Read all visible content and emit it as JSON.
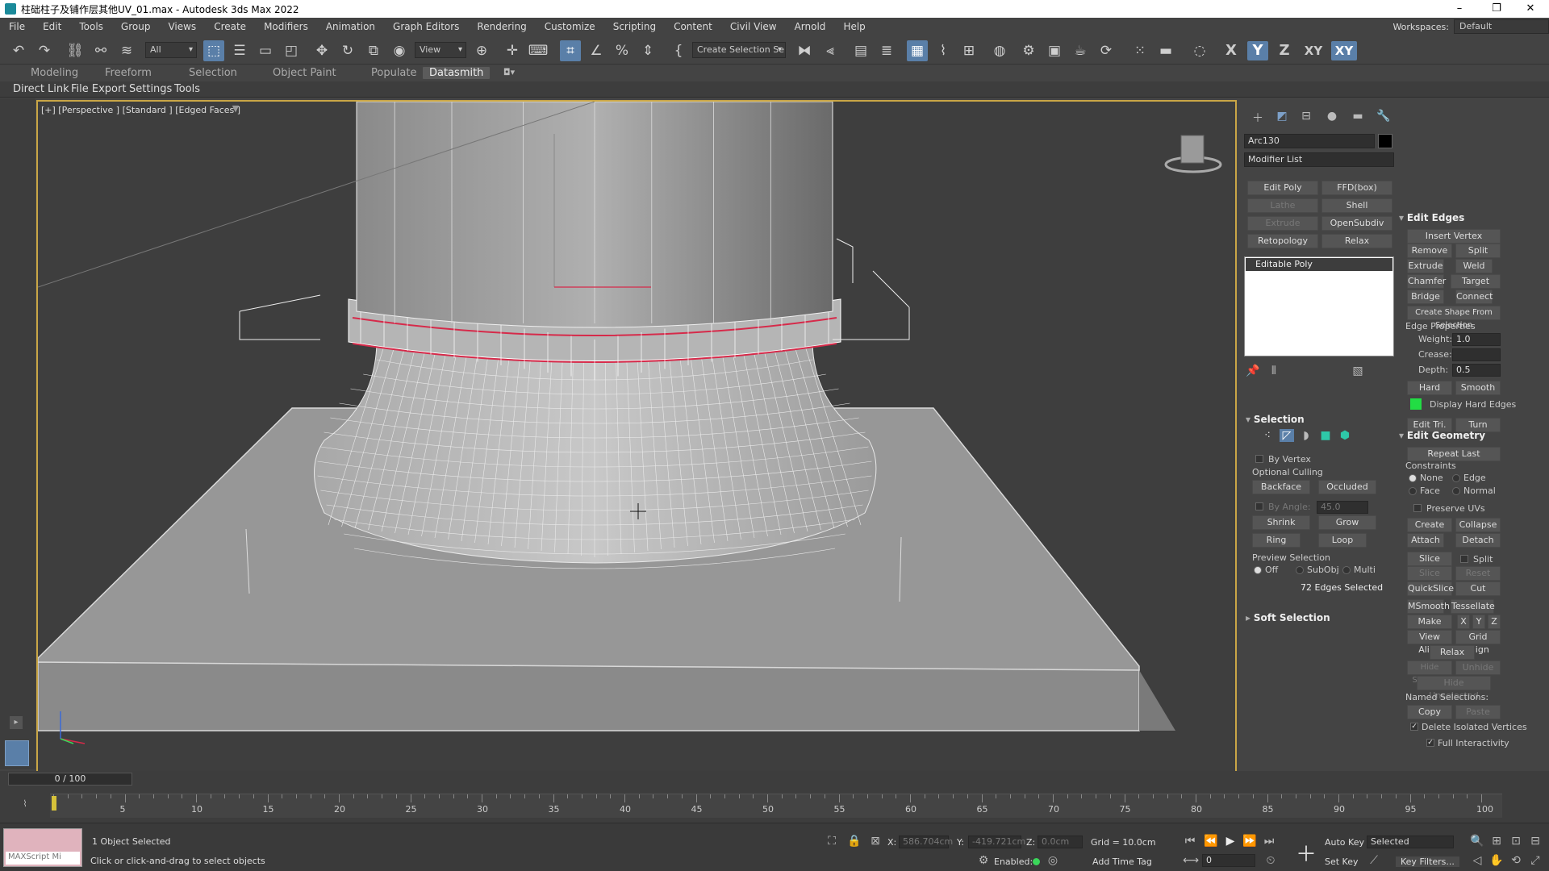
{
  "window": {
    "title": "柱础柱子及铺作层其他UV_01.max - Autodesk 3ds Max 2022",
    "minimize": "–",
    "restore": "❐",
    "close": "✕"
  },
  "menu": [
    "File",
    "Edit",
    "Tools",
    "Group",
    "Views",
    "Create",
    "Modifiers",
    "Animation",
    "Graph Editors",
    "Rendering",
    "Customize",
    "Scripting",
    "Content",
    "Civil View",
    "Arnold",
    "Help"
  ],
  "workspaces": {
    "label": "Workspaces:",
    "value": "Default"
  },
  "toolbar": {
    "filter_value": "All",
    "view_value": "View",
    "selection_set": "Create Selection Se",
    "axes": [
      "X",
      "Y",
      "Z",
      "XY",
      "XY"
    ]
  },
  "ribbon_tabs": [
    "Modeling",
    "Freeform",
    "Selection",
    "Object Paint",
    "Populate",
    "Datasmith"
  ],
  "ribbon_sub": [
    "Direct Link",
    "File Export",
    "Settings",
    "Tools"
  ],
  "viewport": {
    "label": "[+] [Perspective ] [Standard ] [Edged Faces ]"
  },
  "cmd": {
    "object_name": "Arc130",
    "modifier_list": "Modifier List",
    "modifier_buttons": [
      "Edit Poly",
      "FFD(box)",
      "Lathe",
      "Shell",
      "Extrude",
      "OpenSubdiv",
      "Retopology",
      "Relax"
    ],
    "stack_item": "Editable Poly"
  },
  "selection": {
    "title": "Selection",
    "by_vertex": "By Vertex",
    "optional_culling": "Optional Culling",
    "backface": "Backface",
    "occluded": "Occluded",
    "by_angle": "By Angle:",
    "by_angle_value": "45.0",
    "shrink": "Shrink",
    "grow": "Grow",
    "ring": "Ring",
    "loop": "Loop",
    "preview": "Preview Selection",
    "off": "Off",
    "subobj": "SubObj",
    "multi": "Multi",
    "count": "72 Edges Selected"
  },
  "soft_selection": "Soft Selection",
  "edit_edges": {
    "title": "Edit Edges",
    "insert_vertex": "Insert Vertex",
    "remove": "Remove",
    "split": "Split",
    "extrude": "Extrude",
    "weld": "Weld",
    "chamfer": "Chamfer",
    "target_weld": "Target Weld",
    "bridge": "Bridge",
    "connect": "Connect",
    "create_shape": "Create Shape From Selection",
    "edge_props": "Edge Properties",
    "weight": "Weight:",
    "weight_value": "1.0",
    "crease": "Crease:",
    "depth": "Depth:",
    "depth_value": "0.5",
    "hard": "Hard",
    "smooth": "Smooth",
    "display_hard": "Display Hard Edges",
    "edit_tri": "Edit Tri.",
    "turn": "Turn",
    "hard_color": "#22dd44"
  },
  "edit_geometry": {
    "title": "Edit Geometry",
    "repeat_last": "Repeat Last",
    "constraints": "Constraints",
    "none": "None",
    "edge": "Edge",
    "face": "Face",
    "normal": "Normal",
    "preserve_uvs": "Preserve UVs",
    "create": "Create",
    "collapse": "Collapse",
    "attach": "Attach",
    "detach": "Detach",
    "slice_plane": "Slice Plane",
    "split": "Split",
    "slice": "Slice",
    "reset_plane": "Reset Plane",
    "quickslice": "QuickSlice",
    "cut": "Cut",
    "msmooth": "MSmooth",
    "tessellate": "Tessellate",
    "make_planar": "Make Planar",
    "x": "X",
    "y": "Y",
    "z": "Z",
    "view_align": "View Align",
    "grid_align": "Grid Align",
    "relax": "Relax",
    "hide_selected": "Hide Selected",
    "unhide_all": "Unhide All",
    "hide_unselected": "Hide Unselected",
    "named_sel": "Named Selections:",
    "copy": "Copy",
    "paste": "Paste",
    "delete_isolated": "Delete Isolated Vertices",
    "full_interactivity": "Full Interactivity"
  },
  "timeline": {
    "frame": "0 / 100",
    "ticks": [
      "5",
      "10",
      "15",
      "20",
      "25",
      "30",
      "35",
      "40",
      "45",
      "50",
      "55",
      "60",
      "65",
      "70",
      "75",
      "80",
      "85",
      "90",
      "95",
      "100"
    ]
  },
  "status": {
    "maxscript": "MAXScript Mi",
    "objects": "1 Object Selected",
    "prompt": "Click or click-and-drag to select objects",
    "x_label": "X:",
    "x_value": "586.704cm",
    "y_label": "Y:",
    "y_value": "-419.721cm",
    "z_label": "Z:",
    "z_value": "0.0cm",
    "grid": "Grid = 10.0cm",
    "enabled": "Enabled:",
    "add_time_tag": "Add Time Tag",
    "auto_key": "Auto Key",
    "selected": "Selected",
    "set_key": "Set Key",
    "key_filters": "Key Filters...",
    "frame_field": "0"
  }
}
